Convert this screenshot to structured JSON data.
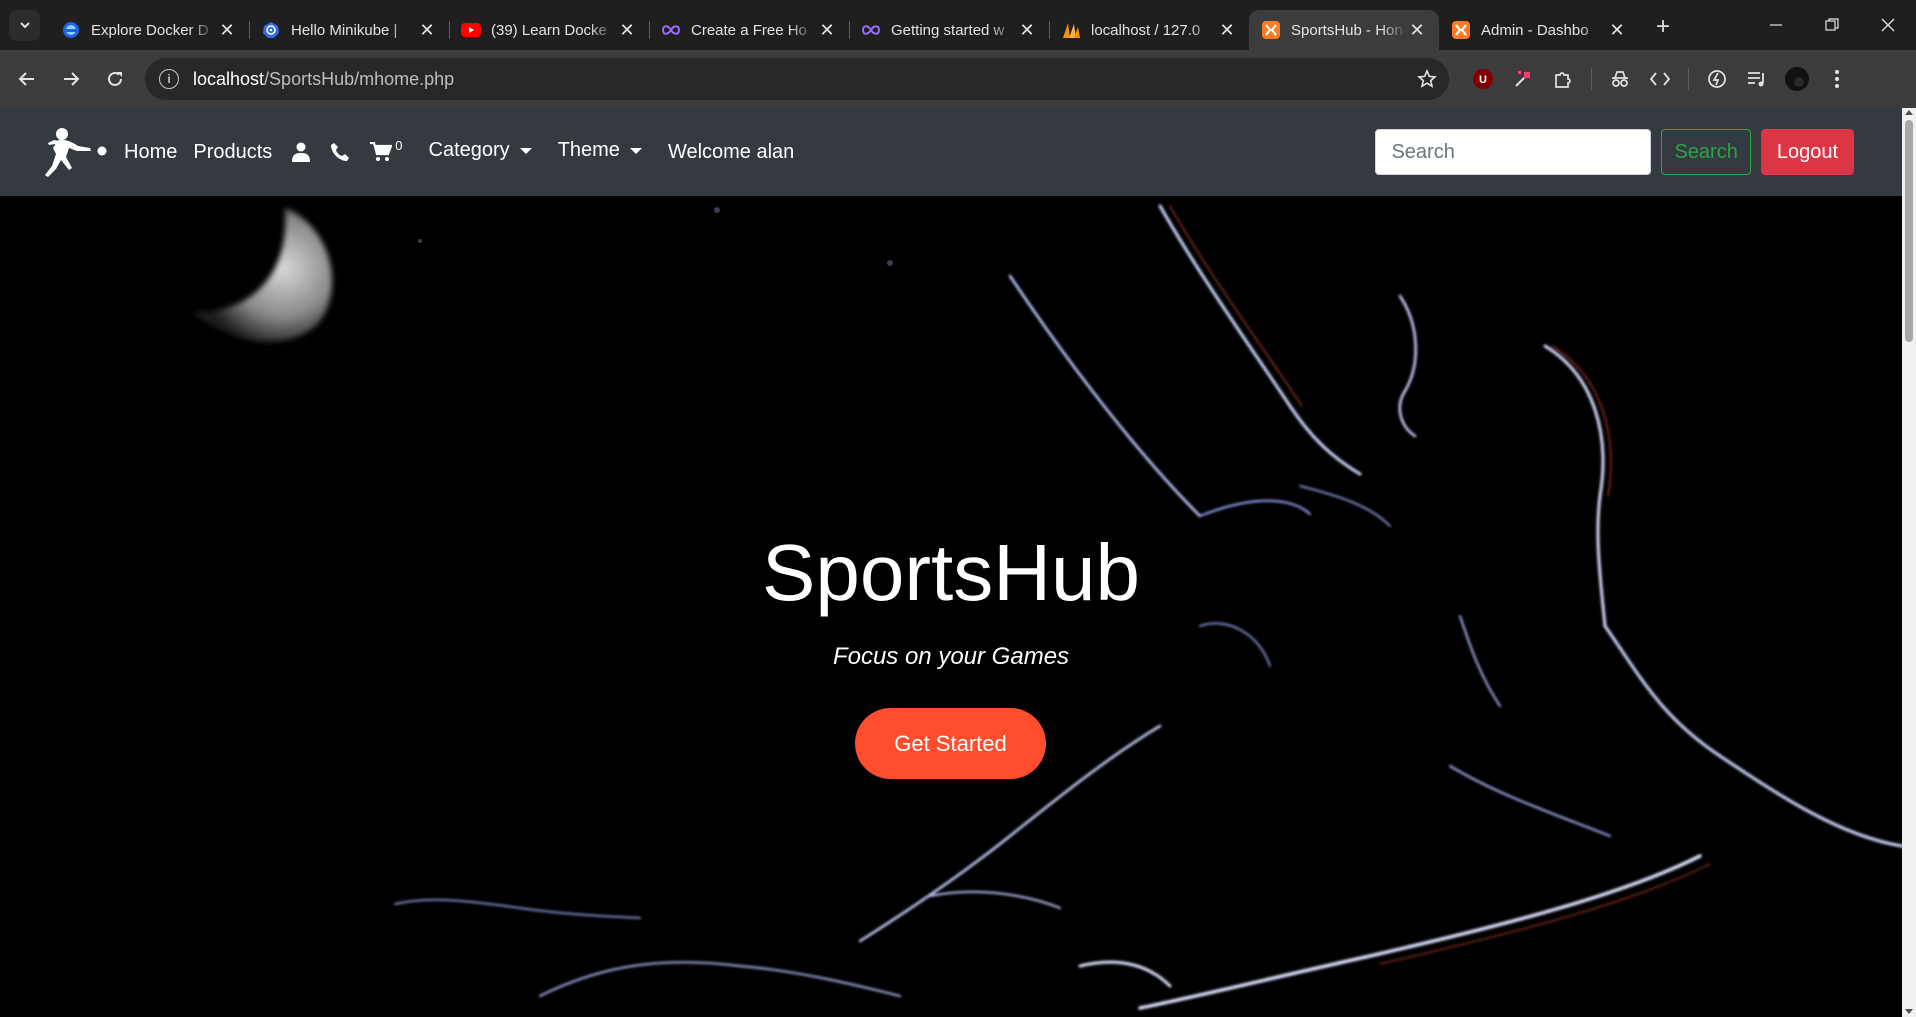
{
  "browser": {
    "tabs": [
      {
        "title": "Explore Docker D",
        "icon": "docker-favicon",
        "active": false
      },
      {
        "title": "Hello Minikube |",
        "icon": "kubernetes-favicon",
        "active": false
      },
      {
        "title": "(39) Learn Docke",
        "icon": "youtube-favicon",
        "active": false
      },
      {
        "title": "Create a Free Ho",
        "icon": "infinity-favicon",
        "active": false
      },
      {
        "title": "Getting started w",
        "icon": "infinity-favicon",
        "active": false
      },
      {
        "title": "localhost / 127.0",
        "icon": "phpmyadmin-favicon",
        "active": false
      },
      {
        "title": "SportsHub - Hon",
        "icon": "xampp-favicon",
        "active": true
      },
      {
        "title": "Admin - Dashbo",
        "icon": "xampp-favicon",
        "active": false
      }
    ],
    "url_host": "localhost",
    "url_path": "/SportsHub/mhome.php",
    "accent": "#ff6b00"
  },
  "navbar": {
    "links": {
      "home": "Home",
      "products": "Products"
    },
    "cart_count": "0",
    "category_label": "Category",
    "theme_label": "Theme",
    "welcome": "Welcome alan",
    "search_placeholder": "Search",
    "search_button": "Search",
    "logout_button": "Logout",
    "colors": {
      "navbar_bg": "#343a40",
      "search_green": "#28a745",
      "logout_red": "#dc3545"
    }
  },
  "hero": {
    "title": "SportsHub",
    "subtitle": "Focus on your Games",
    "cta": "Get Started",
    "cta_color": "#ff4d2e"
  }
}
